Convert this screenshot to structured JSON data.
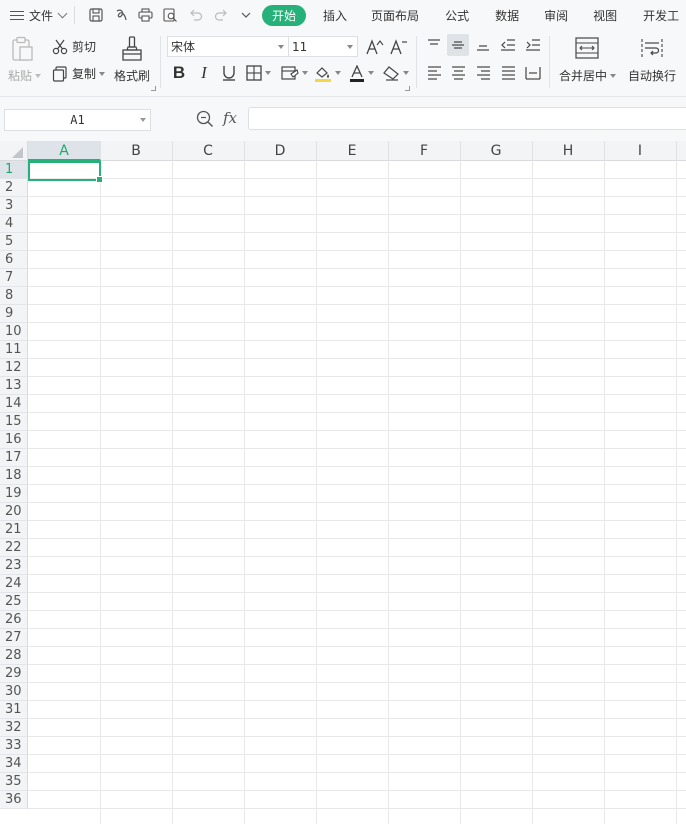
{
  "menubar": {
    "file_label": "文件",
    "tabs": [
      {
        "label": "开始",
        "active": true
      },
      {
        "label": "插入"
      },
      {
        "label": "页面布局"
      },
      {
        "label": "公式"
      },
      {
        "label": "数据"
      },
      {
        "label": "审阅"
      },
      {
        "label": "视图"
      },
      {
        "label": "开发工"
      }
    ],
    "accent_color": "#27b17a"
  },
  "ribbon": {
    "paste_label": "粘贴",
    "cut_label": "剪切",
    "copy_label": "复制",
    "format_painter_label": "格式刷",
    "font_name": "宋体",
    "font_size": "11",
    "merge_center_label": "合并居中",
    "wrap_text_label": "自动换行"
  },
  "formula_bar": {
    "name_box": "A1",
    "fx_label": "fx",
    "formula_value": ""
  },
  "sheet": {
    "columns": [
      "A",
      "B",
      "C",
      "D",
      "E",
      "F",
      "G",
      "H",
      "I"
    ],
    "rows": [
      "1",
      "2",
      "3",
      "4",
      "5",
      "6",
      "7",
      "8",
      "9",
      "10",
      "11",
      "12",
      "13",
      "14",
      "15",
      "16",
      "17",
      "18",
      "19",
      "20",
      "21",
      "22",
      "23",
      "24",
      "25",
      "26",
      "27",
      "28",
      "29",
      "30",
      "31",
      "32",
      "33",
      "34",
      "35",
      "36"
    ],
    "selected_cell": "A1",
    "selection_color": "#27b17a"
  }
}
